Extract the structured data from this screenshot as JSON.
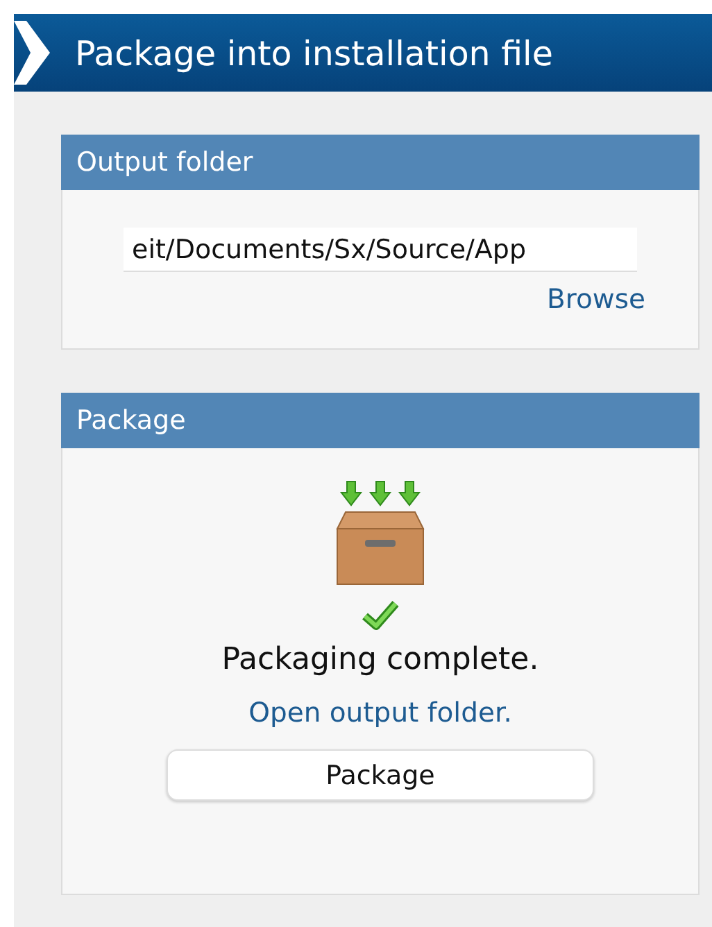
{
  "header": {
    "title": "Package into installation file"
  },
  "sections": [
    {
      "kind": "output",
      "title": "Output folder",
      "path_value": "eit/Documents/Sx/Source/App",
      "browse_link": "Browse"
    },
    {
      "kind": "package",
      "title": "Package",
      "complete": true,
      "status": "Packaging complete.",
      "open_link": "Open output folder.",
      "button": "Package"
    }
  ]
}
